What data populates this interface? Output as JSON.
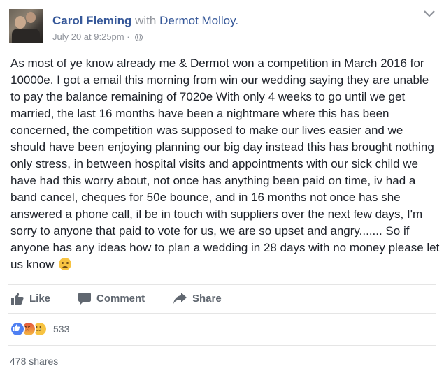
{
  "post": {
    "author": "Carol Fleming",
    "with_text": "with",
    "tagged": "Dermot Molloy.",
    "timestamp": "July 20 at 9:25pm",
    "separator": "·",
    "privacy_icon": "globe-icon",
    "text": "As most of ye know already me & Dermot won a competition in March 2016 for 10000e. I got a email this morning from win our wedding saying they are unable to pay the balance remaining of 7020e With only 4 weeks to go until we get married, the last 16 months have been a nightmare where this has been concerned, the competition was supposed to make our lives easier and we should have been enjoying planning our big day instead this has brought nothing only stress, in between hospital visits and appointments with our sick child we have had this worry about, not once has anything been paid on time, iv had a band cancel, cheques for 50e bounce, and in 16 months not once has she answered a phone call, il be in touch with suppliers over the next few days, I'm sorry to anyone that paid to vote for us, we are so upset and angry....... So if anyone has any ideas how to plan a wedding in 28 days with no money please let us know"
  },
  "actions": {
    "like": "Like",
    "comment": "Comment",
    "share": "Share"
  },
  "reactions": {
    "icons": [
      "like-reaction-icon",
      "angry-reaction-icon",
      "sad-reaction-icon"
    ],
    "count": "533"
  },
  "shares": "478 shares",
  "colors": {
    "link": "#365899",
    "meta": "#90949c",
    "action": "#606770"
  }
}
